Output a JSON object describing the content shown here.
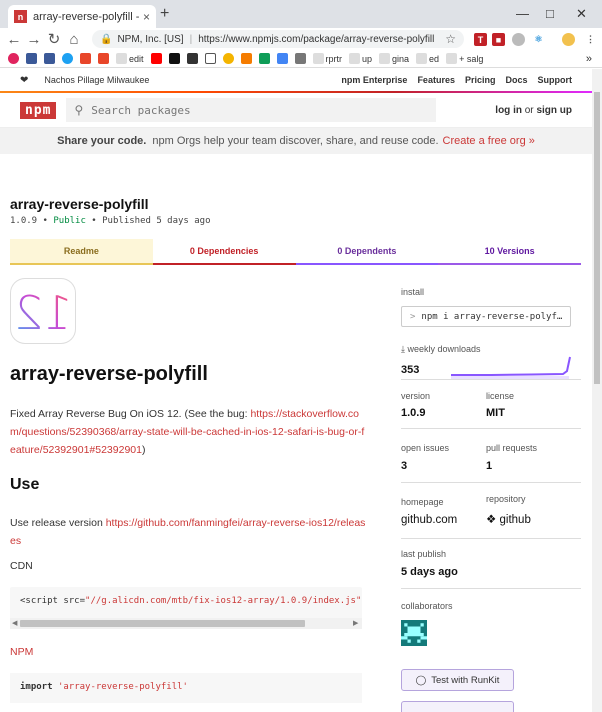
{
  "browser": {
    "tab_title": "array-reverse-polyfill - npm",
    "tab_favicon": "n",
    "close_glyph": "×",
    "newtab_glyph": "+",
    "url_org": "NPM, Inc. [US]",
    "url": "https://www.npmjs.com/package/array-reverse-polyfill",
    "bookmarks": [
      "edit",
      "rprtr",
      "up",
      "gina",
      "ed",
      "+ salg"
    ],
    "more": "»"
  },
  "npm": {
    "org_label": "Nachos Pillage Milwaukee",
    "nav": [
      "npm Enterprise",
      "Features",
      "Pricing",
      "Docs",
      "Support"
    ],
    "logo": "npm",
    "search_placeholder": "Search packages",
    "login": "log in",
    "or": "or",
    "signup": "sign up",
    "promo_bold": "Share your code.",
    "promo_text": "npm Orgs help your team discover, share, and reuse code.",
    "promo_link": "Create a free org »"
  },
  "package": {
    "name": "array-reverse-polyfill",
    "version": "1.0.9",
    "visibility": "Public",
    "published": "Published 5 days ago",
    "tabs": {
      "readme": "Readme",
      "deps": "0  Dependencies",
      "dependents": "0  Dependents",
      "versions": "10  Versions"
    }
  },
  "readme": {
    "logo_text": "12",
    "h1": "array-reverse-polyfill",
    "desc": "Fixed Array Reverse Bug On iOS 12. (See the bug:",
    "desc_link": "https://stackoverflow.com/questions/52390368/array-state-will-be-cached-in-ios-12-safari-is-bug-or-feature/52392901#52392901",
    "desc_end": ")",
    "use_h2": "Use",
    "use_text": "Use release version",
    "use_link": "https://github.com/fanmingfei/array-reverse-ios12/releases",
    "cdn": "CDN",
    "code1_a": "<script src=",
    "code1_b": "\"//g.alicdn.com/mtb/fix-ios12-array/1.0.9/index.js\"",
    "npm_h": "NPM",
    "code2_kw": "import",
    "code2_str": "'array-reverse-polyfill'"
  },
  "sidebar": {
    "install_label": "install",
    "install_prompt": ">",
    "install_cmd": "npm i array-reverse-polyf…",
    "downloads_label": "weekly downloads",
    "downloads": "353",
    "version_label": "version",
    "version": "1.0.9",
    "license_label": "license",
    "license": "MIT",
    "issues_label": "open issues",
    "issues": "3",
    "pulls_label": "pull requests",
    "pulls": "1",
    "homepage_label": "homepage",
    "homepage": "github.com",
    "repo_label": "repository",
    "repo": "github",
    "lastpub_label": "last publish",
    "lastpub": "5 days ago",
    "collab_label": "collaborators",
    "runkit": "Test with RunKit"
  }
}
